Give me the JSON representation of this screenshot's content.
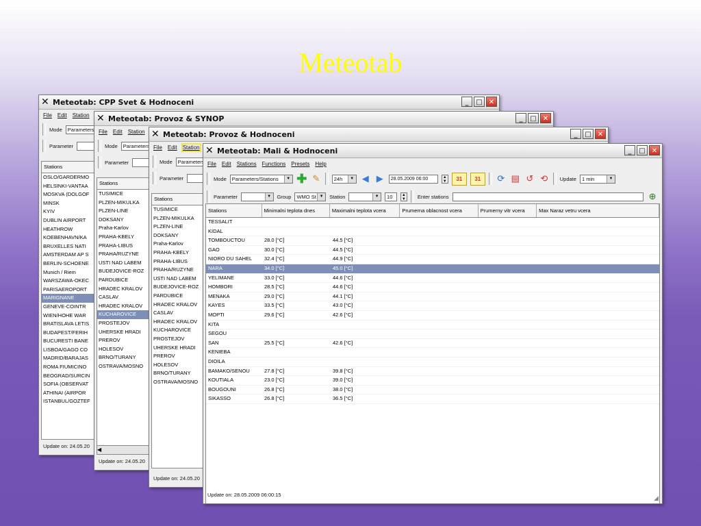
{
  "slide": {
    "title": "Meteotab"
  },
  "win1": {
    "title": "Meteotab: CPP Svet & Hodnoceni",
    "menu": [
      "File",
      "Edit",
      "Station"
    ],
    "mode_label": "Mode",
    "mode_value": "Parameters",
    "parameter_label": "Parameter",
    "stations_header": "Stations",
    "stations": [
      "OSLO/GARDERMO",
      "HELSINKI-VANTAA",
      "MOSKVA (DOLGOF",
      "MINSK",
      "KYIV",
      "DUBLIN AIRPORT",
      "HEATHROW",
      "KOEBENHAVN/KA",
      "BRUXELLES NATI",
      "AMSTERDAM AP S",
      "BERLIN-SCHOENE",
      "Munich / Riem",
      "WARSZAWA-OKEC",
      "PARISAEROPORT",
      "MARIGNANE",
      "GENEVE-COINTR",
      "WIEN/HOHE WAR",
      "BRATISLAVA LETIS",
      "BUDAPEST/FERIH",
      "BUCURESTI BANE",
      "LISBOA/GAGO CO",
      "MADRID/BARAJAS",
      "ROMA FIUMICINO",
      "BEOGRAD/SURCIN",
      "SOFIA (OBSERVAT",
      "ATHINAI (AIRPOR",
      "ISTANBUL/GOZTEF"
    ],
    "selected_index": 14,
    "status": "Update on: 24.05.20"
  },
  "win2": {
    "title": "Meteotab: Provoz & SYNOP",
    "menu": [
      "File",
      "Edit",
      "Station"
    ],
    "mode_label": "Mode",
    "mode_value": "Parameters",
    "parameter_label": "Parameter",
    "stations_header": "Stations",
    "stations": [
      "TUSIMICE",
      "PLZEN-MIKULKA",
      "PLZEN-LINE",
      "DOKSANY",
      "Praha-Karlov",
      "PRAHA-KBELY",
      "PRAHA-LIBUS",
      "PRAHA/RUZYNE",
      "USTI NAD LABEM",
      "BUDEJOVICE-ROZ",
      "PARDUBICE",
      "HRADEC KRALOV",
      "CASLAV",
      "HRADEC KRALOV",
      "KUCHAROVICE",
      "PROSTEJOV",
      "UHERSKE HRADI",
      "PREROV",
      "HOLESOV",
      "BRNO/TURANY",
      "OSTRAVA/MOSNO"
    ],
    "selected_index": 14,
    "status": "Update on: 24.05.20"
  },
  "win3": {
    "title": "Meteotab: Provoz & Hodnoceni",
    "menu": [
      "File",
      "Edit",
      "Station"
    ],
    "mode_label": "Mode",
    "mode_value": "Parameters",
    "parameter_label": "Parameter",
    "stations_header": "Stations",
    "stations": [
      "TUSIMICE",
      "PLZEN-MIKULKA",
      "PLZEN-LINE",
      "DOKSANY",
      "Praha-Karlov",
      "PRAHA-KBELY",
      "PRAHA-LIBUS",
      "PRAHA/RUZYNE",
      "USTI NAD LABEM",
      "BUDEJOVICE-ROZ",
      "PARDUBICE",
      "HRADEC KRALOV",
      "CASLAV",
      "HRADEC KRALOV",
      "KUCHAROVICE",
      "PROSTEJOV",
      "UHERSKE HRADI",
      "PREROV",
      "HOLESOV",
      "BRNO/TURANY",
      "OSTRAVA/MOSNO"
    ],
    "status": "Update on: 24.05.20"
  },
  "win4": {
    "title": "Meteotab: Mali & Hodnoceni",
    "menu": [
      "File",
      "Edit",
      "Stations",
      "Functions",
      "Presets",
      "Help"
    ],
    "mode_label": "Mode",
    "mode_value": "Parameters/Stations",
    "interval_value": "24h",
    "datetime_value": "28.05.2009 06:00",
    "calendar1": "31",
    "calendar2": "31",
    "update_label": "Update",
    "update_value": "1 min",
    "parameter_label": "Parameter",
    "group_label": "Group",
    "group_value": "WMO St",
    "station_label": "Station",
    "count_value": "10",
    "enter_stations_label": "Enter stations",
    "columns": [
      "Stations",
      "Minimalni teplota dnes",
      "Maximalni teplota vcera",
      "Prumerna oblacnost vcera",
      "Prumerny vitr vcera",
      "Max Naraz vetru vcera"
    ],
    "rows": [
      [
        "TESSALIT",
        "",
        ""
      ],
      [
        "KIDAL",
        "",
        ""
      ],
      [
        "TOMBOUCTOU",
        "28.0 [°C]",
        "44.5 [°C]"
      ],
      [
        "GAO",
        "30.0 [°C]",
        "44.5 [°C]"
      ],
      [
        "NIORO DU SAHEL",
        "32.4 [°C]",
        "44.9 [°C]"
      ],
      [
        "NARA",
        "34.0 [°C]",
        "45.0 [°C]"
      ],
      [
        "YELIMANE",
        "33.0 [°C]",
        "44.6 [°C]"
      ],
      [
        "HOMBORI",
        "28.5 [°C]",
        "44.6 [°C]"
      ],
      [
        "MENAKA",
        "29.0 [°C]",
        "44.1 [°C]"
      ],
      [
        "KAYES",
        "33.5 [°C]",
        "43.0 [°C]"
      ],
      [
        "MOPTI",
        "29.6 [°C]",
        "42.6 [°C]"
      ],
      [
        "KITA",
        "",
        ""
      ],
      [
        "SEGOU",
        "",
        ""
      ],
      [
        "SAN",
        "25.5 [°C]",
        "42.6 [°C]"
      ],
      [
        "KENIEBA",
        "",
        ""
      ],
      [
        "DIOILA",
        "",
        ""
      ],
      [
        "BAMAKO/SENOU",
        "27.8 [°C]",
        "39.8 [°C]"
      ],
      [
        "KOUTIALA",
        "23.0 [°C]",
        "39.0 [°C]"
      ],
      [
        "BOUGOUNI",
        "26.8 [°C]",
        "38.0 [°C]"
      ],
      [
        "SIKASSO",
        "26.8 [°C]",
        "36.5 [°C]"
      ]
    ],
    "selected_index": 5,
    "status": "Update on: 28.05.2009 06:00:15"
  }
}
